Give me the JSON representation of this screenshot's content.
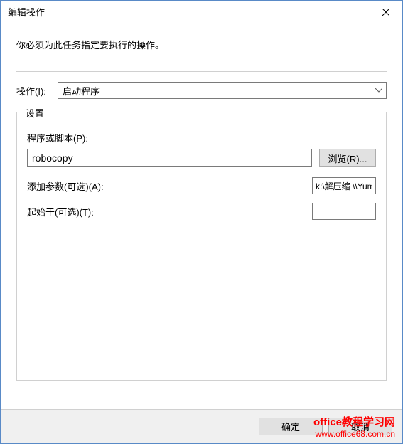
{
  "window": {
    "title": "编辑操作"
  },
  "instruction": "你必须为此任务指定要执行的操作。",
  "action": {
    "label": "操作(I):",
    "selected": "启动程序"
  },
  "settings": {
    "legend": "设置",
    "script_label": "程序或脚本(P):",
    "script_value": "robocopy",
    "browse_label": "浏览(R)...",
    "args_label": "添加参数(可选)(A):",
    "args_value": "k:\\解压缩 \\\\Yumufa",
    "startin_label": "起始于(可选)(T):",
    "startin_value": ""
  },
  "buttons": {
    "ok": "确定",
    "cancel": "取消"
  },
  "watermark": {
    "line1": "office教程学习网",
    "line2": "www.office68.com.cn"
  }
}
